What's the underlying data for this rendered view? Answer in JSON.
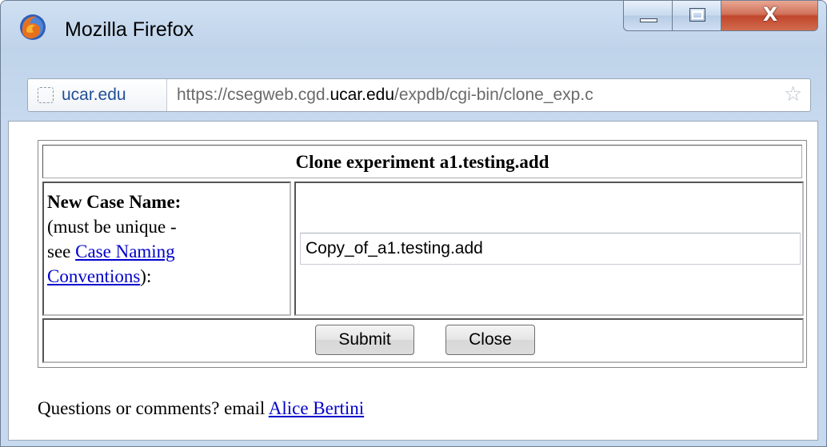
{
  "window": {
    "title": "Mozilla Firefox",
    "close_glyph": "X"
  },
  "urlbar": {
    "site_identity": "ucar.edu",
    "url_prefix": "https://csegweb.cgd.",
    "url_domain": "ucar.edu",
    "url_suffix": "/expdb/cgi-bin/clone_exp.c",
    "bookmark_star": "☆"
  },
  "form": {
    "heading": "Clone experiment a1.testing.add",
    "label_title": "New Case Name:",
    "label_line2": "(must be unique -",
    "label_see": "see ",
    "link_line1": "Case Naming",
    "link_line2": "Conventions",
    "label_end": "):",
    "case_name_value": "Copy_of_a1.testing.add",
    "submit_label": "Submit",
    "close_label": "Close"
  },
  "footer": {
    "text": "Questions or comments? email ",
    "contact_name": "Alice Bertini"
  },
  "colors": {
    "link": "#0000cc",
    "close_button": "#c0462c"
  }
}
